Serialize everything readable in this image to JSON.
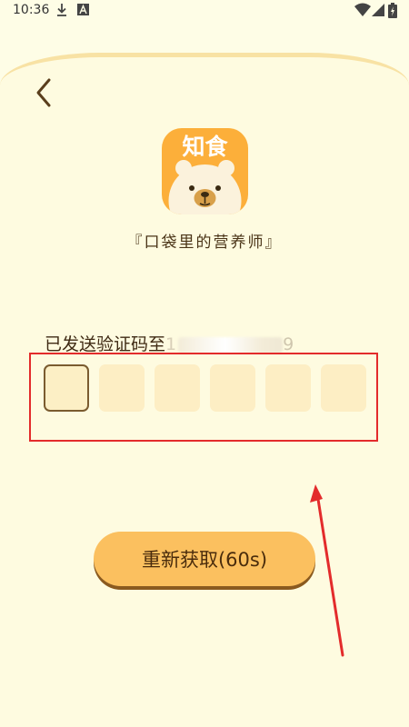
{
  "status_bar": {
    "time": "10:36",
    "icons": [
      "download-icon",
      "a-notification-icon",
      "wifi-icon",
      "signal-icon",
      "battery-charging-icon"
    ]
  },
  "header": {
    "back_icon": "chevron-left-icon"
  },
  "logo": {
    "text": "知食"
  },
  "slogan": "『口袋里的营养师』",
  "verification": {
    "sent_label": "已发送验证码至",
    "phone_prefix": "1",
    "phone_suffix": "9",
    "code_length": 6
  },
  "resend_button": {
    "label": "重新获取(60s)"
  },
  "colors": {
    "background": "#fefde6",
    "card_border": "#f8e2a4",
    "code_box": "#fdeec4",
    "active_border": "#7a5b2f",
    "button": "#fbc05f",
    "button_shadow": "#8a5a1f",
    "logo_orange": "#fcaf3a",
    "highlight_red": "#e32b2b"
  }
}
